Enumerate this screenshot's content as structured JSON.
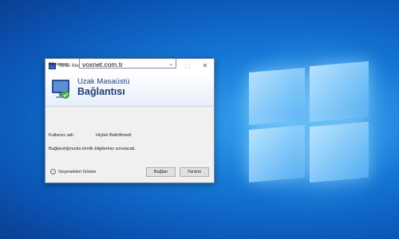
{
  "window": {
    "title": "Uzak Masaüstü Bağlantısı",
    "controls": {
      "minimize": "—",
      "maximize": "▢",
      "close": "✕"
    }
  },
  "banner": {
    "line1": "Uzak Masaüstü",
    "line2": "Bağlantısı"
  },
  "form": {
    "computer_label": "Bilgisayar:",
    "computer_value": "voxnet.com.tr",
    "user_label": "Kullanıcı adı:",
    "user_value": "Hiçbiri Belirtilmedi",
    "info_text": "Bağlandığınızda kimlik bilgileriniz sorulacak."
  },
  "footer": {
    "options_label": "Seçenekleri Göster",
    "connect_label": "Bağlan",
    "help_label": "Yardım"
  },
  "icons": {
    "app": "remote-desktop-icon",
    "options": "chevron-down-circle-icon",
    "dropdown": "chevron-down-icon"
  }
}
